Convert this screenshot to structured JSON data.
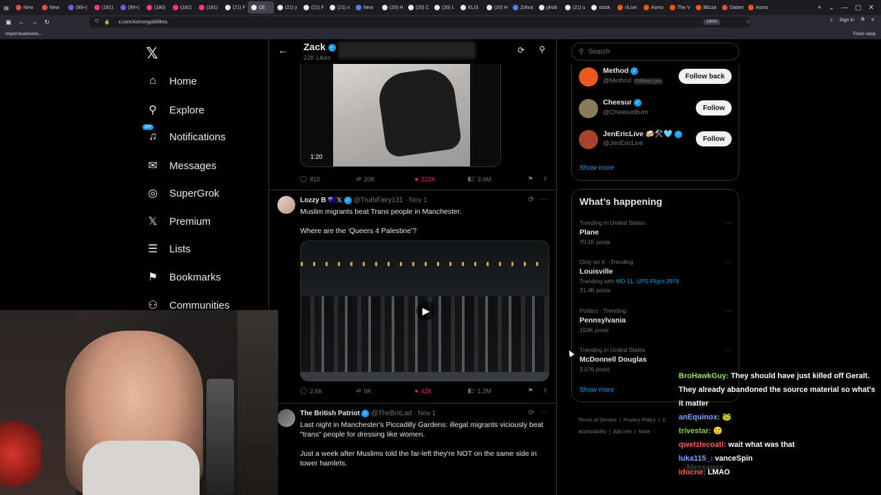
{
  "browser": {
    "tabs": [
      {
        "label": "New",
        "color": "#e2513b"
      },
      {
        "label": "New",
        "color": "#e2513b"
      },
      {
        "label": "(99+)",
        "color": "#6d5cf6"
      },
      {
        "label": "(181)",
        "color": "#ff3b6b"
      },
      {
        "label": "(99+)",
        "color": "#6d5cf6"
      },
      {
        "label": "(180)",
        "color": "#ff3b6b"
      },
      {
        "label": "(181)",
        "color": "#ff3b6b"
      },
      {
        "label": "(181)",
        "color": "#ff3b6b"
      },
      {
        "label": "(21) F",
        "color": "#e7e9ea"
      },
      {
        "label": "(2(",
        "color": "#e7e9ea",
        "active": true
      },
      {
        "label": "(21) y",
        "color": "#e7e9ea"
      },
      {
        "label": "(21) F",
        "color": "#e7e9ea"
      },
      {
        "label": "(21) n",
        "color": "#e7e9ea"
      },
      {
        "label": "New",
        "color": "#5a78ff"
      },
      {
        "label": "(20) H",
        "color": "#e7e9ea"
      },
      {
        "label": "(20) C",
        "color": "#e7e9ea"
      },
      {
        "label": "(20) L",
        "color": "#e7e9ea"
      },
      {
        "label": "ELIS",
        "color": "#e7e9ea"
      },
      {
        "label": "(20) H",
        "color": "#e7e9ea"
      },
      {
        "label": "Zohra",
        "color": "#5a78ff"
      },
      {
        "label": "phob",
        "color": "#e7e9ea"
      },
      {
        "label": "(21) u",
        "color": "#e7e9ea"
      },
      {
        "label": "stock",
        "color": "#e7e9ea"
      },
      {
        "label": "r/Live",
        "color": "#ff5700"
      },
      {
        "label": "Asmo",
        "color": "#ff5700"
      },
      {
        "label": "The V",
        "color": "#ff5700"
      },
      {
        "label": "Blizza",
        "color": "#ff5700"
      },
      {
        "label": "Datam",
        "color": "#e2513b"
      },
      {
        "label": "Asmo",
        "color": "#ff5700"
      }
    ],
    "url": "x.com/Asmongold/likes",
    "zoom": "140%",
    "sign_in": "Sign in",
    "import_bookmarks": "Import bookmarks...",
    "finish_setup": "Finish setup"
  },
  "nav": {
    "logo": "𝕏",
    "notif_badge": "20+",
    "items": [
      {
        "label": "Home",
        "icon": "home-icon",
        "glyph": "⌂"
      },
      {
        "label": "Explore",
        "icon": "search-icon",
        "glyph": "⚲"
      },
      {
        "label": "Notifications",
        "icon": "bell-icon",
        "glyph": "♫"
      },
      {
        "label": "Messages",
        "icon": "mail-icon",
        "glyph": "✉"
      },
      {
        "label": "SuperGrok",
        "icon": "grok-icon",
        "glyph": "◎"
      },
      {
        "label": "Premium",
        "icon": "x-premium-icon",
        "glyph": "𝕏"
      },
      {
        "label": "Lists",
        "icon": "list-icon",
        "glyph": "☰"
      },
      {
        "label": "Bookmarks",
        "icon": "bookmark-icon",
        "glyph": "⚑"
      },
      {
        "label": "Communities",
        "icon": "communities-icon",
        "glyph": "⚇"
      }
    ]
  },
  "profile": {
    "name": "Zack",
    "likes": "22K Likes"
  },
  "tweets": [
    {
      "video_time": "1:20",
      "replies": "815",
      "reposts": "20K",
      "likes": "222K",
      "views": "3.4M"
    },
    {
      "author": "Lozzy B 🇦🇺𝕏",
      "handle": "@TruthFairy131",
      "date": "· Nov 1",
      "text1": "Muslim migrants beat Trans people in Manchester.",
      "text2": "Where are the ‘Queers 4 Palestine’?",
      "replies": "2.6K",
      "reposts": "9K",
      "likes": "42K",
      "views": "1.2M"
    },
    {
      "author": "The British Patriot",
      "handle": "@TheBritLad",
      "date": "· Nov 1",
      "text1": "Last night in Manchester's Piccadilly Gardens: illegal migrants viciously beat \"trans\" people for dressing like women.",
      "text2": "Just a week after Muslims told the far-left they're NOT on the same side in tower hamlets."
    }
  ],
  "right": {
    "search_placeholder": "Search",
    "who_to_follow": [
      {
        "name": "Method",
        "handle": "@Method",
        "tag": "Follows you",
        "button": "Follow back",
        "color": "#e85a1e"
      },
      {
        "name": "Cheesur",
        "handle": "@CheesurBurn",
        "tag": "",
        "button": "Follow",
        "color": "#8a7a5c"
      },
      {
        "name": "JenEricLive 🍻⚒️🩵",
        "handle": "@JenEricLive",
        "tag": "",
        "button": "Follow",
        "color": "#a8442a"
      }
    ],
    "show_more": "Show more",
    "happening_title": "What’s happening",
    "trends": [
      {
        "meta": "Trending in United States",
        "name": "Plane",
        "posts": "70.1K posts"
      },
      {
        "meta": "Only on X · Trending",
        "name": "Louisville",
        "with_label": "Trending with",
        "with_links": "MD-11, UPS Flight 2976",
        "posts": "31.4K posts"
      },
      {
        "meta": "Politics · Trending",
        "name": "Pennsylvania",
        "posts": "150K posts"
      },
      {
        "meta": "Trending in United States",
        "name": "McDonnell Douglas",
        "posts": "3,076 posts"
      }
    ],
    "show_more2": "Show more",
    "footer": [
      "Terms of Service",
      "|",
      "Privacy Policy",
      "|",
      "C",
      "Accessibility",
      "|",
      "Ads info",
      "|",
      "More ···"
    ]
  },
  "chat": {
    "lines": [
      {
        "user": "BroHawkGuy:",
        "msg": "They should have just killed off Geralt. They already abandoned the source material so what's it matter",
        "cls": "green2"
      },
      {
        "user": "anEquinox:",
        "msg": "🐸",
        "cls": "blue"
      },
      {
        "user": "trivestar:",
        "msg": "🙂",
        "cls": ""
      },
      {
        "user": "qwetzlecoatl:",
        "msg": "wait what was that",
        "cls": "red"
      },
      {
        "user": "luka115_:",
        "msg": "vanceSpin",
        "cls": "blue"
      },
      {
        "user": "idocne:",
        "msg": "LMAO",
        "cls": "red"
      }
    ],
    "ghost": "Messages"
  }
}
